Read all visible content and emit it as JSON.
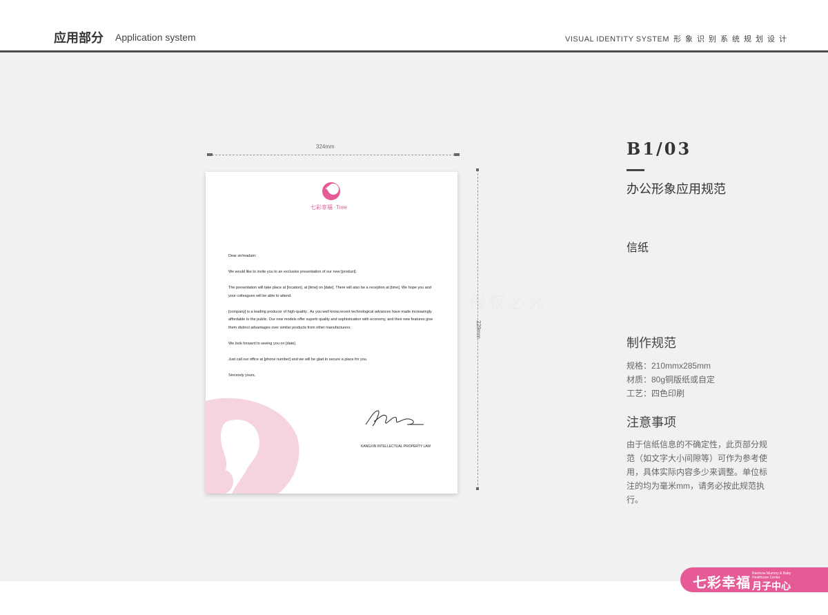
{
  "header": {
    "title_cn": "应用部分",
    "title_en": "Application system",
    "right_en": "VISUAL IDENTITY SYSTEM",
    "right_cn": "形象识别系统规划设计"
  },
  "dimensions": {
    "width_label": "324mm",
    "height_label": "229mm"
  },
  "letterhead": {
    "logo_text": "七彩幸福 ·Tree",
    "letter_paragraphs": [
      "Dear sir/madam:",
      "We would like to invite you to an exclusive presentation of our new [product].",
      "The presentation will take place at [location], at [time] on [date]. There will also be a reception at [time]. We hope you and your colleagues will be able to attend.",
      "[company] is a leading producer of high-quality . As you well know,recent technological advances have made increasingly affordable to the public. Our new models offer superb quality and sophistication with economy, and their new features give them distinct advantages over similar products from other manufacturers.",
      "We look forward to seeing you on [date].",
      "Just call our office at [phone number] and we will be glad to secure a place for you.",
      "Sincerely yours,"
    ],
    "signature_caption": "KANGXIN INTELLECTUAL PROPERTY LAW"
  },
  "info": {
    "code": "B1/03",
    "section_title": "办公形象应用规范",
    "item_name": "信纸",
    "make_title": "制作规范",
    "specs": [
      "规格：210mmx285mm",
      "材质：80g铜版纸或自定",
      "工艺：四色印刷"
    ],
    "note_title": "注意事项",
    "note_text": "由于信纸信息的不确定性，此页部分规范（如文字大小间隙等）可作为参考使用，具体实际内容多少来调整。单位标注的均为毫米mm，请务必按此规范执行。"
  },
  "watermark_text": "侵权必究",
  "brand": {
    "name_cn": "七彩幸福",
    "sub_en": "Rainbow Mummy & Baby Healthcare Center",
    "tail_cn": "月子中心"
  },
  "colors": {
    "brand_pink": "#e65a95",
    "watermark_pink": "#f6d3e0",
    "header_rule": "#4a4a4a"
  }
}
